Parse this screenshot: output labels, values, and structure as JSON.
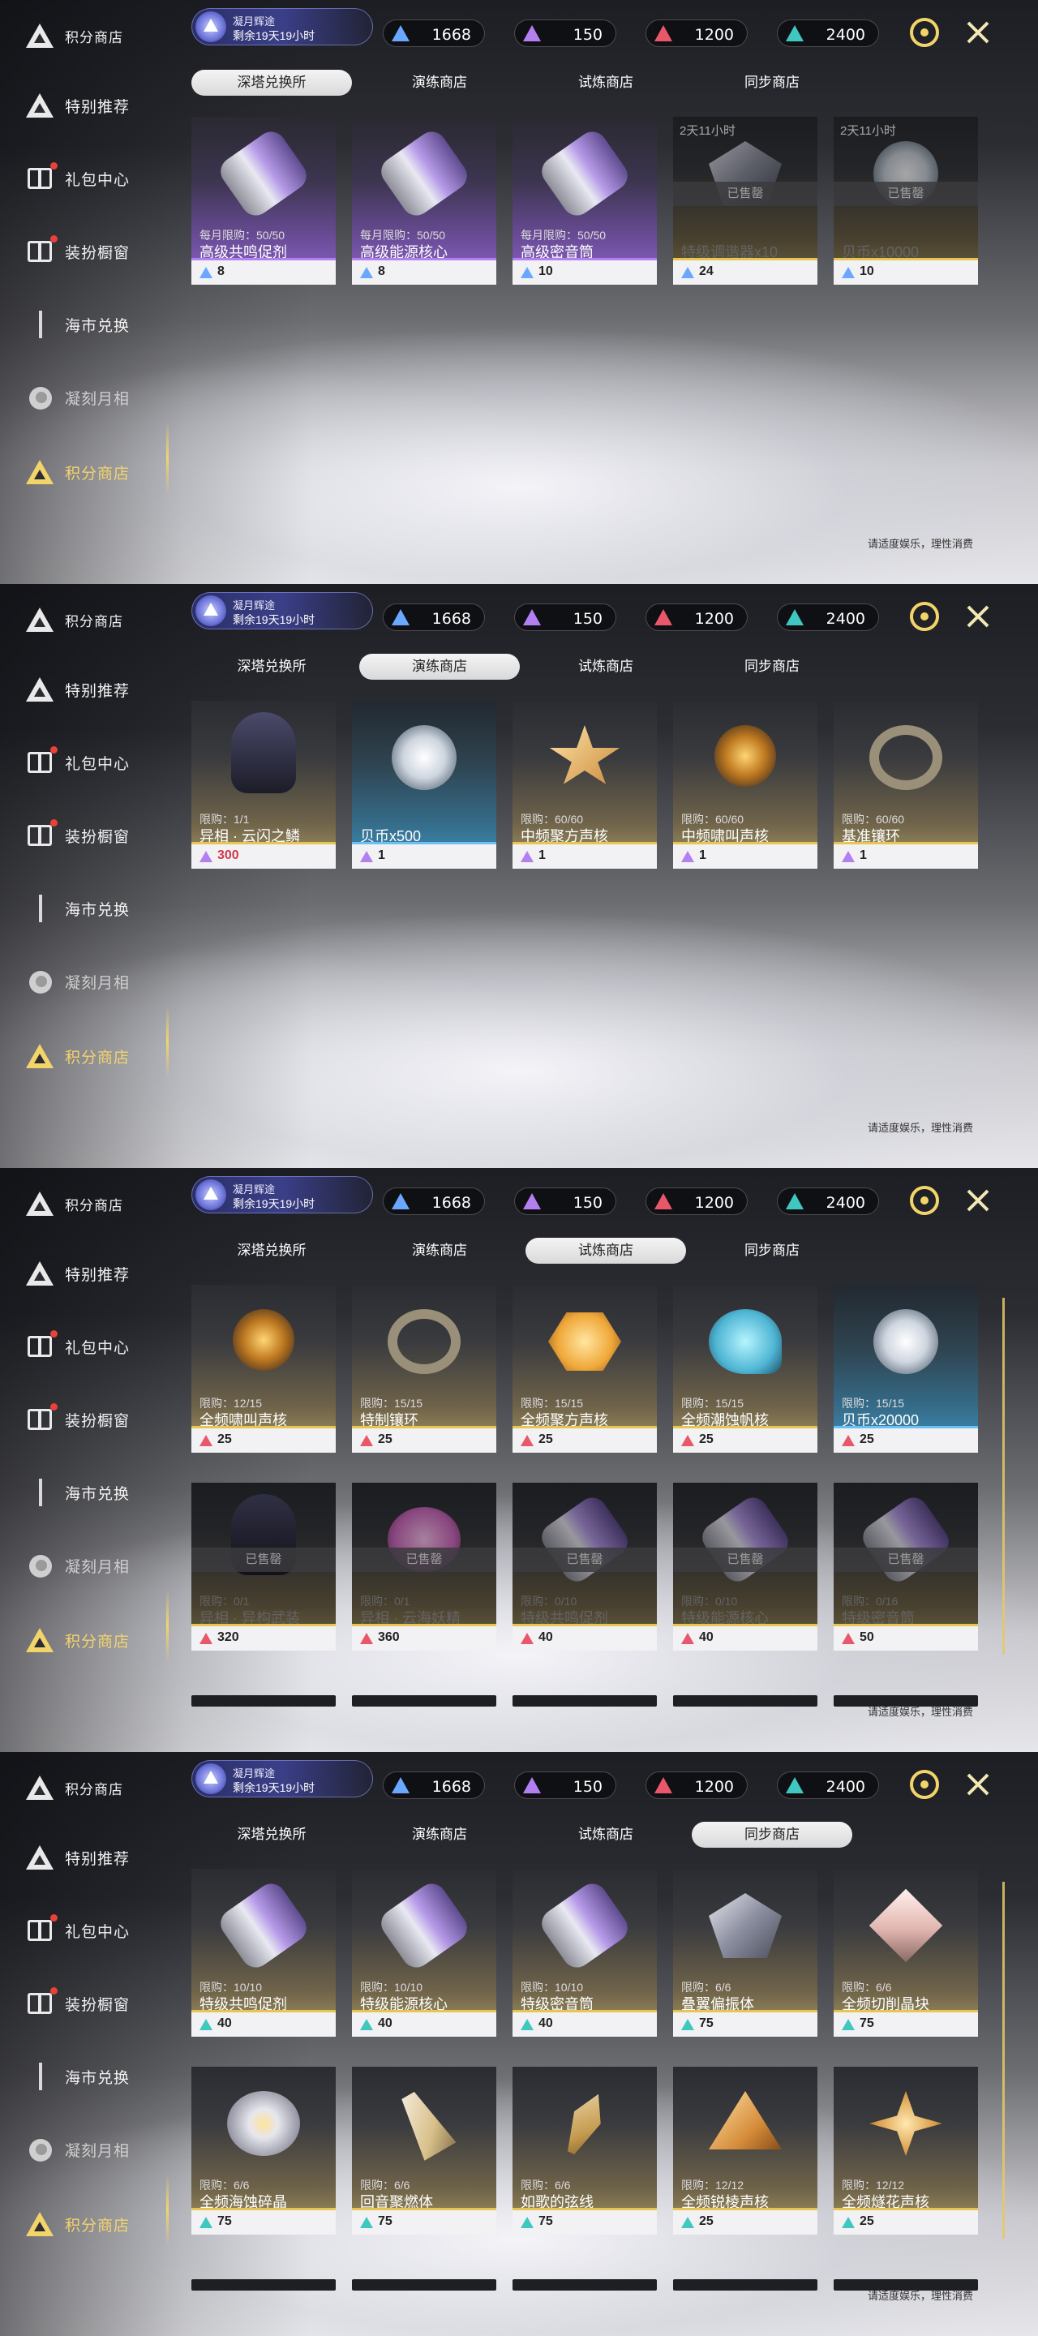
{
  "sidebar": {
    "header": "积分商店",
    "items": [
      "特别推荐",
      "礼包中心",
      "装扮橱窗",
      "海市兑换",
      "凝刻月相",
      "积分商店"
    ]
  },
  "event": {
    "title": "凝月辉途",
    "remaining": "剩余19天19小时"
  },
  "currencies": [
    {
      "value": "1668",
      "color": "#6aa8ff"
    },
    {
      "value": "150",
      "color": "#b47ff0"
    },
    {
      "value": "1200",
      "color": "#e8576a"
    },
    {
      "value": "2400",
      "color": "#3fc7c0"
    }
  ],
  "tabs": [
    "深塔兑换所",
    "演练商店",
    "试炼商店",
    "同步商店"
  ],
  "footer": "请适度娱乐，理性消费",
  "screens": [
    {
      "active_tab": 0,
      "cards": [
        {
          "name": "高级共鸣促剂",
          "limit": "每月限购：50/50",
          "price": "8",
          "gem": "#6aa8ff",
          "tier": "purple",
          "shape": "cyl"
        },
        {
          "name": "高级能源核心",
          "limit": "每月限购：50/50",
          "price": "8",
          "gem": "#6aa8ff",
          "tier": "purple",
          "shape": "cyl"
        },
        {
          "name": "高级密音筒",
          "limit": "每月限购：50/50",
          "price": "10",
          "gem": "#6aa8ff",
          "tier": "purple",
          "shape": "cyl"
        },
        {
          "name": "特级调谐器x10",
          "limit": "",
          "price": "24",
          "gem": "#6aa8ff",
          "tier": "gold",
          "shape": "crystal",
          "sold": "已售罄",
          "timer": "2天11小时"
        },
        {
          "name": "贝币x10000",
          "limit": "",
          "price": "10",
          "gem": "#6aa8ff",
          "tier": "gold",
          "shape": "coin",
          "sold": "已售罄",
          "timer": "2天11小时"
        }
      ]
    },
    {
      "active_tab": 1,
      "cards": [
        {
          "name": "异相 · 云闪之鳞",
          "limit": "限购：1/1",
          "price": "300",
          "gem": "#b47ff0",
          "tier": "gold",
          "shape": "head",
          "red": true
        },
        {
          "name": "贝币x500",
          "limit": "",
          "price": "1",
          "gem": "#b47ff0",
          "tier": "blue",
          "shape": "coin"
        },
        {
          "name": "中频聚方声核",
          "limit": "限购：60/60",
          "price": "1",
          "gem": "#b47ff0",
          "tier": "gold",
          "shape": "star"
        },
        {
          "name": "中频啸叫声核",
          "limit": "限购：60/60",
          "price": "1",
          "gem": "#b47ff0",
          "tier": "gold",
          "shape": "orb"
        },
        {
          "name": "基准镶环",
          "limit": "限购：60/60",
          "price": "1",
          "gem": "#b47ff0",
          "tier": "gold",
          "shape": "ring"
        }
      ]
    },
    {
      "active_tab": 2,
      "cards": [
        {
          "name": "全频啸叫声核",
          "limit": "限购：12/15",
          "price": "25",
          "gem": "#e8576a",
          "tier": "gold",
          "shape": "orb"
        },
        {
          "name": "特制镶环",
          "limit": "限购：15/15",
          "price": "25",
          "gem": "#e8576a",
          "tier": "gold",
          "shape": "ring"
        },
        {
          "name": "全频聚方声核",
          "limit": "限购：15/15",
          "price": "25",
          "gem": "#e8576a",
          "tier": "gold",
          "shape": "hex"
        },
        {
          "name": "全频潮蚀帆核",
          "limit": "限购：15/15",
          "price": "25",
          "gem": "#e8576a",
          "tier": "gold",
          "shape": "shell"
        },
        {
          "name": "贝币x20000",
          "limit": "限购：15/15",
          "price": "25",
          "gem": "#e8576a",
          "tier": "blue",
          "shape": "coin"
        },
        {
          "name": "异相 · 异构武装",
          "limit": "限购：0/1",
          "price": "320",
          "gem": "#e8576a",
          "tier": "gold",
          "shape": "head",
          "sold": "已售罄"
        },
        {
          "name": "异相 · 云海妖精",
          "limit": "限购：0/1",
          "price": "360",
          "gem": "#e8576a",
          "tier": "gold",
          "shape": "pink",
          "sold": "已售罄"
        },
        {
          "name": "特级共鸣促剂",
          "limit": "限购：0/10",
          "price": "40",
          "gem": "#e8576a",
          "tier": "gold",
          "shape": "cyl",
          "sold": "已售罄"
        },
        {
          "name": "特级能源核心",
          "limit": "限购：0/10",
          "price": "40",
          "gem": "#e8576a",
          "tier": "gold",
          "shape": "cyl",
          "sold": "已售罄"
        },
        {
          "name": "特级密音筒",
          "limit": "限购：0/16",
          "price": "50",
          "gem": "#e8576a",
          "tier": "gold",
          "shape": "cyl",
          "sold": "已售罄"
        }
      ]
    },
    {
      "active_tab": 3,
      "cards": [
        {
          "name": "特级共鸣促剂",
          "limit": "限购：10/10",
          "price": "40",
          "gem": "#3fc7c0",
          "tier": "gold",
          "shape": "cyl"
        },
        {
          "name": "特级能源核心",
          "limit": "限购：10/10",
          "price": "40",
          "gem": "#3fc7c0",
          "tier": "gold",
          "shape": "cyl"
        },
        {
          "name": "特级密音筒",
          "limit": "限购：10/10",
          "price": "40",
          "gem": "#3fc7c0",
          "tier": "gold",
          "shape": "cyl"
        },
        {
          "name": "叠翼偏振体",
          "limit": "限购：6/6",
          "price": "75",
          "gem": "#3fc7c0",
          "tier": "gold",
          "shape": "crystal"
        },
        {
          "name": "全频切削晶块",
          "limit": "限购：6/6",
          "price": "75",
          "gem": "#3fc7c0",
          "tier": "gold",
          "shape": "cube"
        },
        {
          "name": "全频海蚀碎晶",
          "limit": "限购：6/6",
          "price": "75",
          "gem": "#3fc7c0",
          "tier": "gold",
          "shape": "disc"
        },
        {
          "name": "回音聚燃体",
          "limit": "限购：6/6",
          "price": "75",
          "gem": "#3fc7c0",
          "tier": "gold",
          "shape": "shard"
        },
        {
          "name": "如歌的弦线",
          "limit": "限购：6/6",
          "price": "75",
          "gem": "#3fc7c0",
          "tier": "gold",
          "shape": "leaf"
        },
        {
          "name": "全频锐棱声核",
          "limit": "限购：12/12",
          "price": "25",
          "gem": "#3fc7c0",
          "tier": "gold",
          "shape": "tri"
        },
        {
          "name": "全频燧花声核",
          "limit": "限购：12/12",
          "price": "25",
          "gem": "#3fc7c0",
          "tier": "gold",
          "shape": "flower"
        }
      ]
    }
  ]
}
